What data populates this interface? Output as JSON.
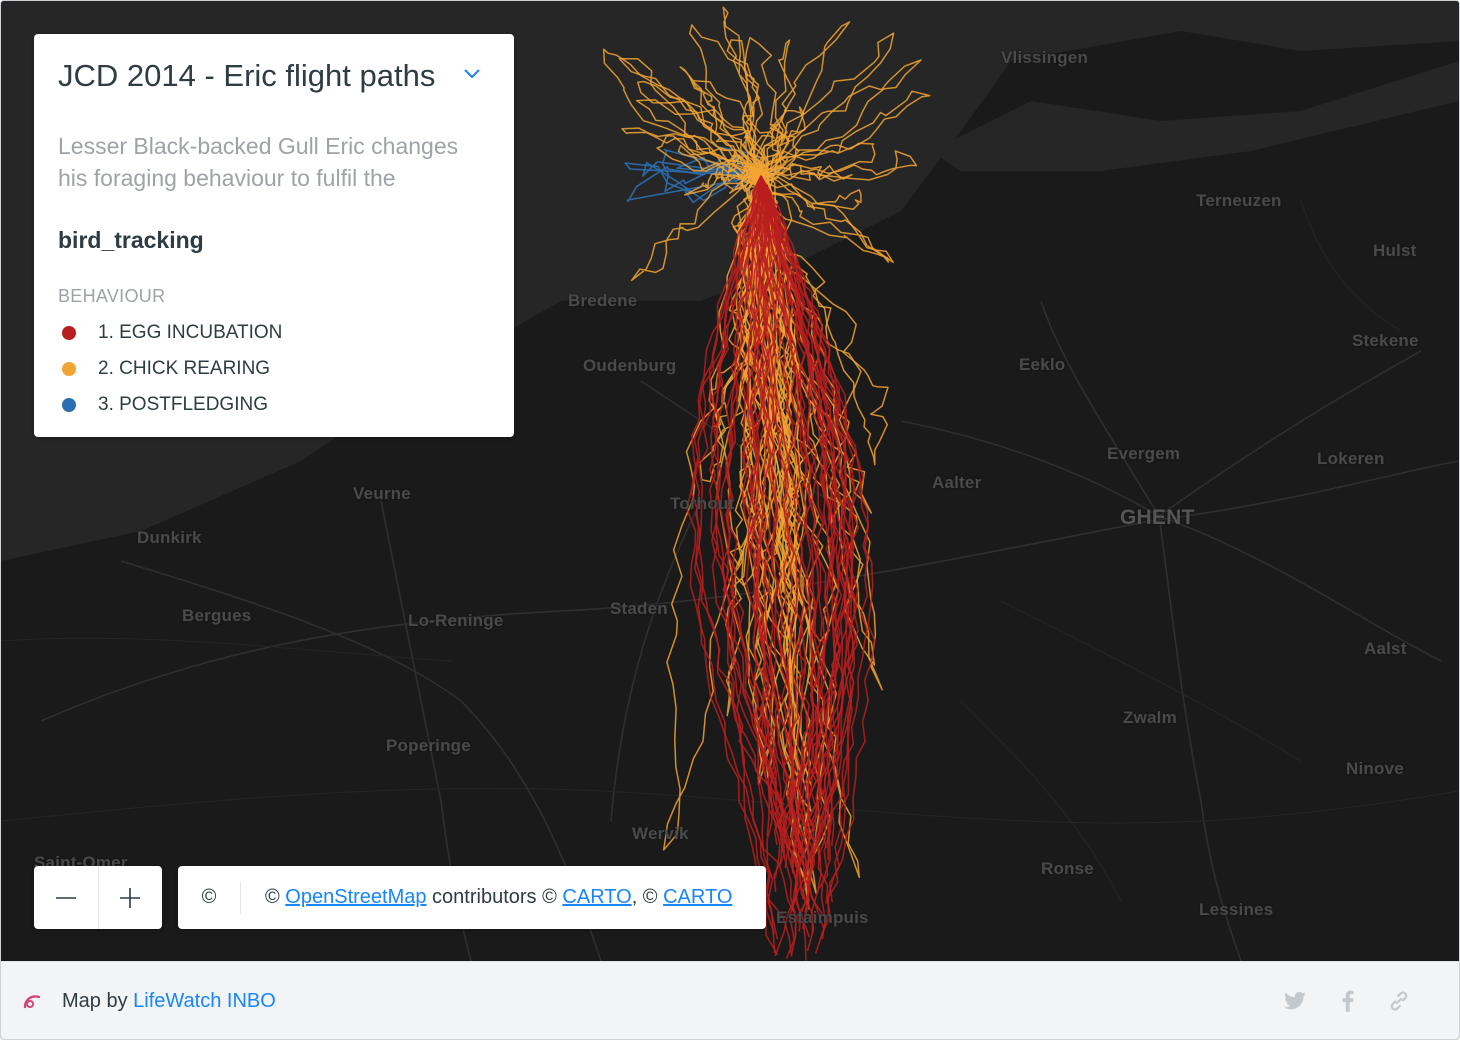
{
  "legend": {
    "title": "JCD 2014 - Eric flight paths",
    "description": "Lesser Black-backed Gull Eric changes his foraging behaviour to fulfil the",
    "layer_name": "bird_tracking",
    "category_header": "BEHAVIOUR",
    "items": [
      {
        "label": "1. EGG INCUBATION",
        "color": "#b81e1e"
      },
      {
        "label": "2. CHICK REARING",
        "color": "#f3a533"
      },
      {
        "label": "3. POSTFLEDGING",
        "color": "#2c6fb0"
      }
    ]
  },
  "map": {
    "basemap": "dark",
    "places": [
      "Vlissingen",
      "Terneuzen",
      "Hulst",
      "Bredene",
      "Oudenburg",
      "Eeklo",
      "Stekene",
      "Evergem",
      "Lokeren",
      "Aalter",
      "Torhout",
      "Veurne",
      "GHENT",
      "Dunkirk",
      "Bergues",
      "Lo-Reninge",
      "Staden",
      "Aalst",
      "Zwalm",
      "Poperinge",
      "Ninove",
      "Wervik",
      "Ronse",
      "Lessines",
      "Saint-Omer",
      "Estaimpuis"
    ],
    "zoom_out_icon": "minus-icon",
    "zoom_in_icon": "plus-icon"
  },
  "attribution": {
    "copyright_symbol": "©",
    "prefix": "© ",
    "osm": "OpenStreetMap",
    "middle": " contributors © ",
    "carto1": "CARTO",
    "sep": ", © ",
    "carto2": "CARTO"
  },
  "footer": {
    "map_by": "Map by ",
    "author": "LifeWatch INBO",
    "icons": [
      "twitter-icon",
      "facebook-icon",
      "link-icon"
    ]
  }
}
